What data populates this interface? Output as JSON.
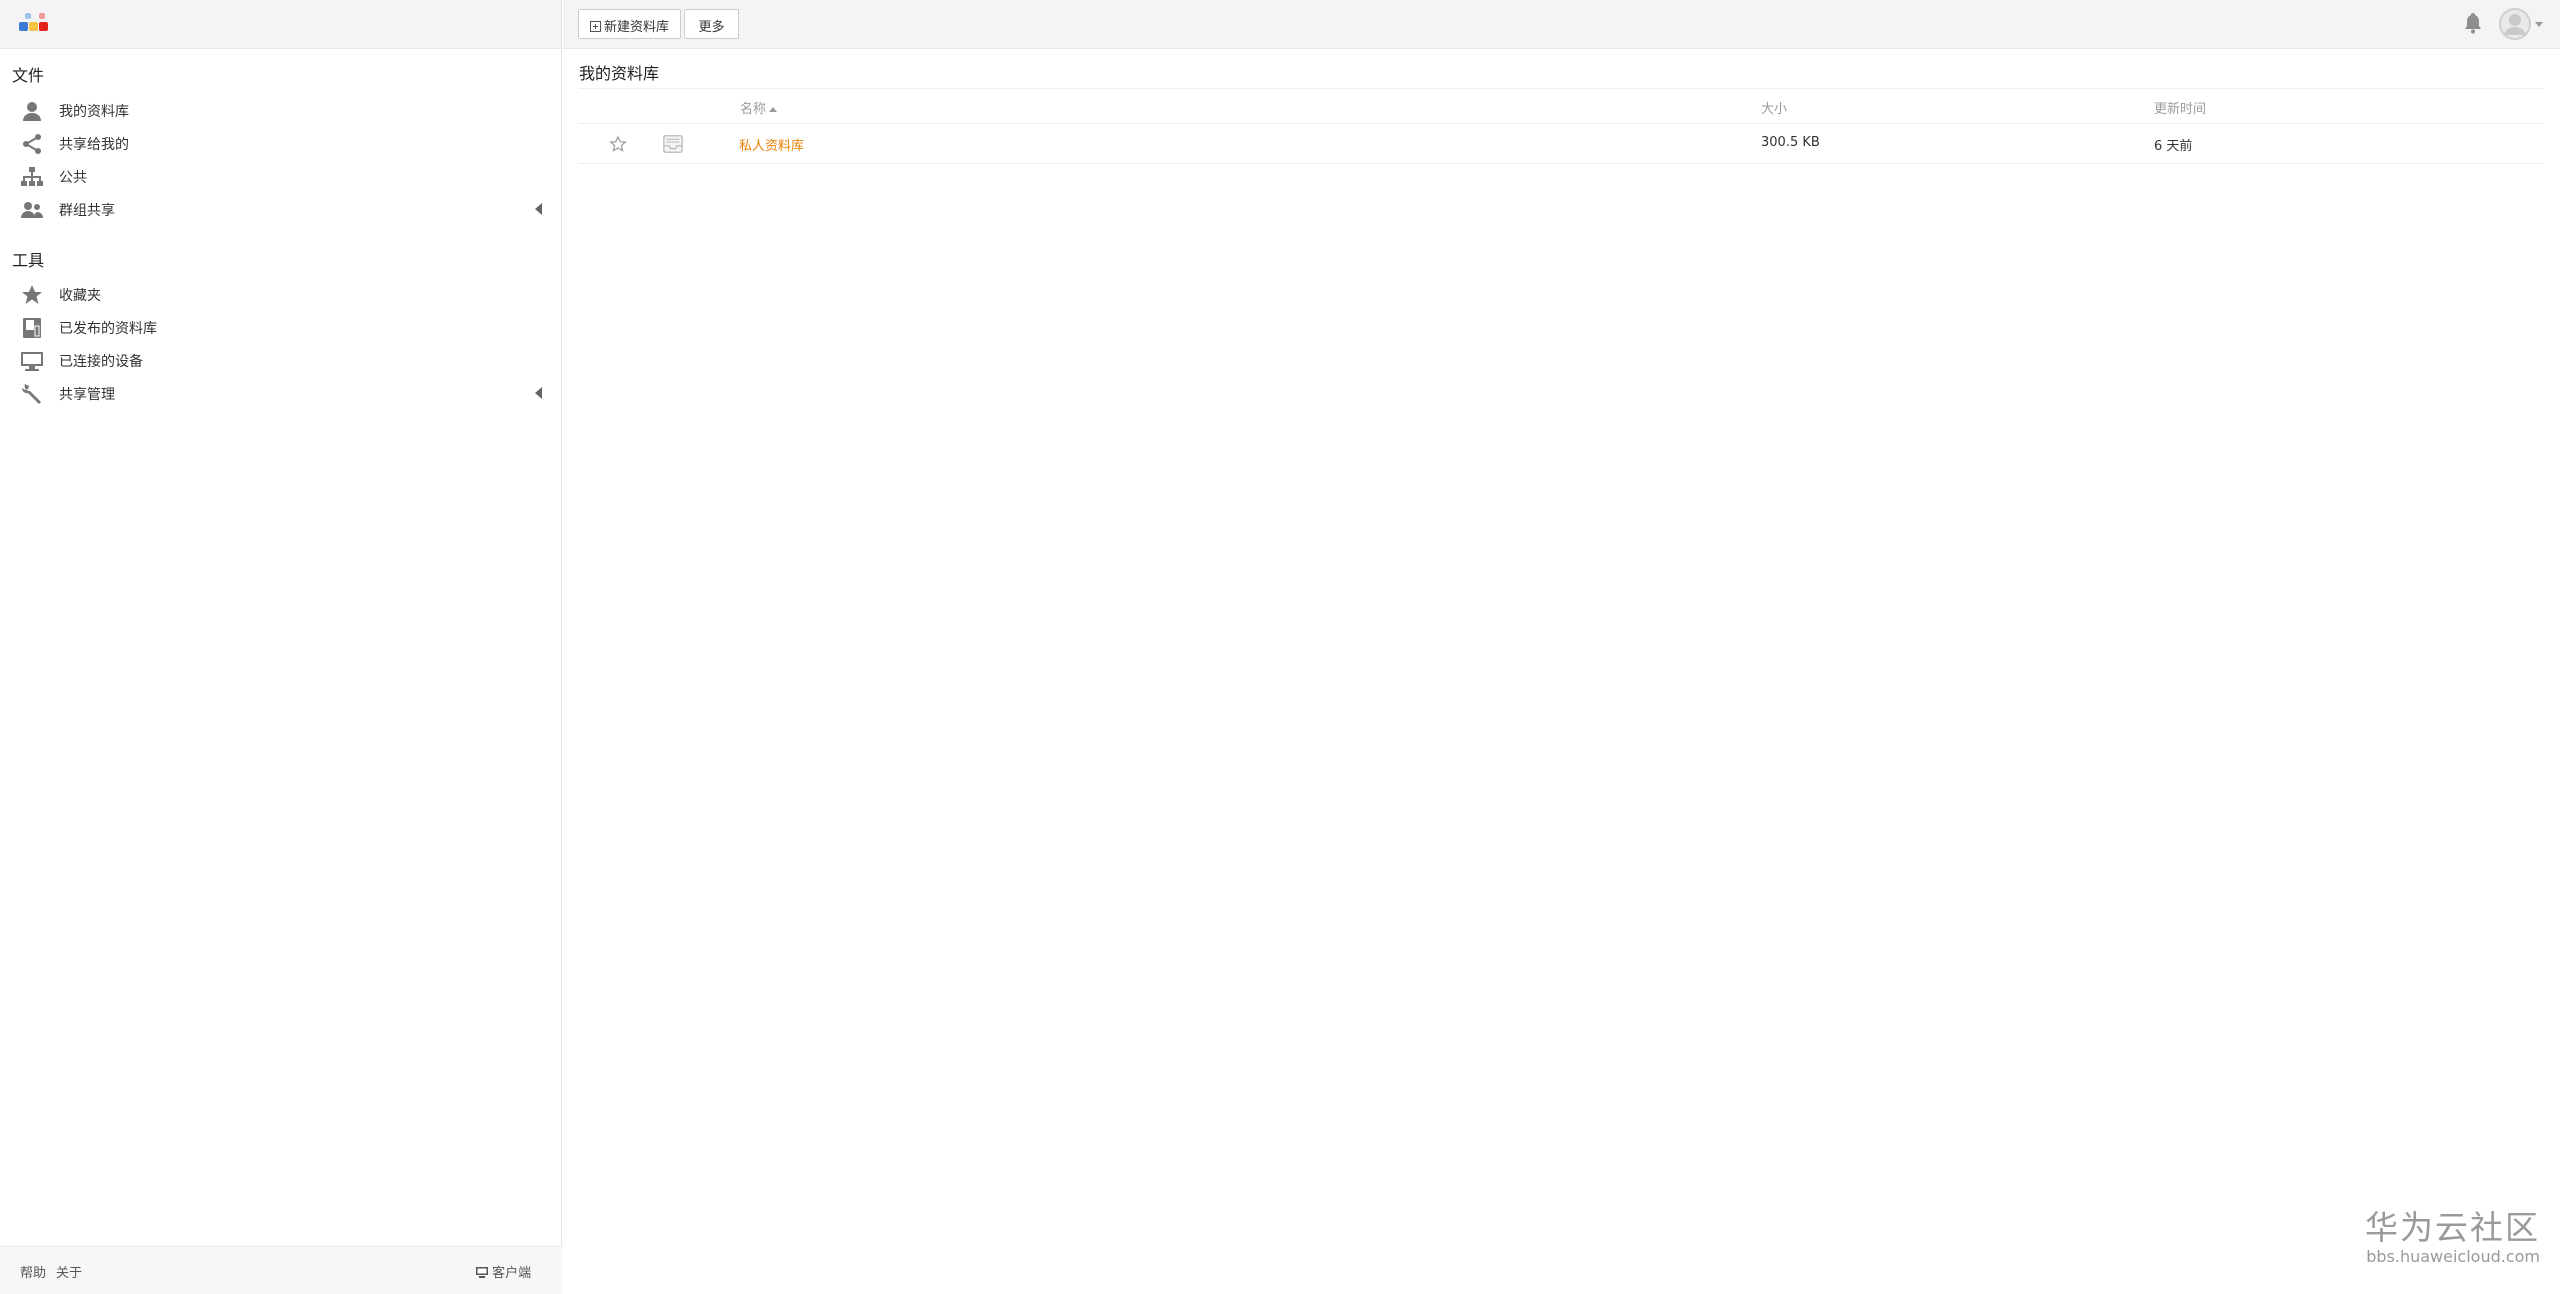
{
  "sidebar": {
    "files_title": "文件",
    "files_items": [
      {
        "label": "我的资料库",
        "icon": "user-icon"
      },
      {
        "label": "共享给我的",
        "icon": "share-icon"
      },
      {
        "label": "公共",
        "icon": "org-chart-icon"
      },
      {
        "label": "群组共享",
        "icon": "group-icon",
        "expandable": true
      }
    ],
    "tools_title": "工具",
    "tools_items": [
      {
        "label": "收藏夹",
        "icon": "star-icon"
      },
      {
        "label": "已发布的资料库",
        "icon": "book-icon"
      },
      {
        "label": "已连接的设备",
        "icon": "monitor-icon"
      },
      {
        "label": "共享管理",
        "icon": "wrench-icon",
        "expandable": true
      }
    ],
    "footer": {
      "help": "帮助",
      "about": "关于",
      "client": "客户端"
    }
  },
  "toolbar": {
    "new_library": "新建资料库",
    "more": "更多"
  },
  "main": {
    "title": "我的资料库",
    "columns": {
      "name": "名称",
      "size": "大小",
      "updated": "更新时间"
    },
    "rows": [
      {
        "name": "私人资料库",
        "size": "300.5 KB",
        "updated": "6 天前"
      }
    ]
  },
  "colors": {
    "accent": "#eb8205",
    "header_bg": "#f4f4f7",
    "icon_gray": "#777777"
  },
  "watermark": {
    "brand": "华为云社区",
    "url": "bbs.huaweicloud.com"
  }
}
